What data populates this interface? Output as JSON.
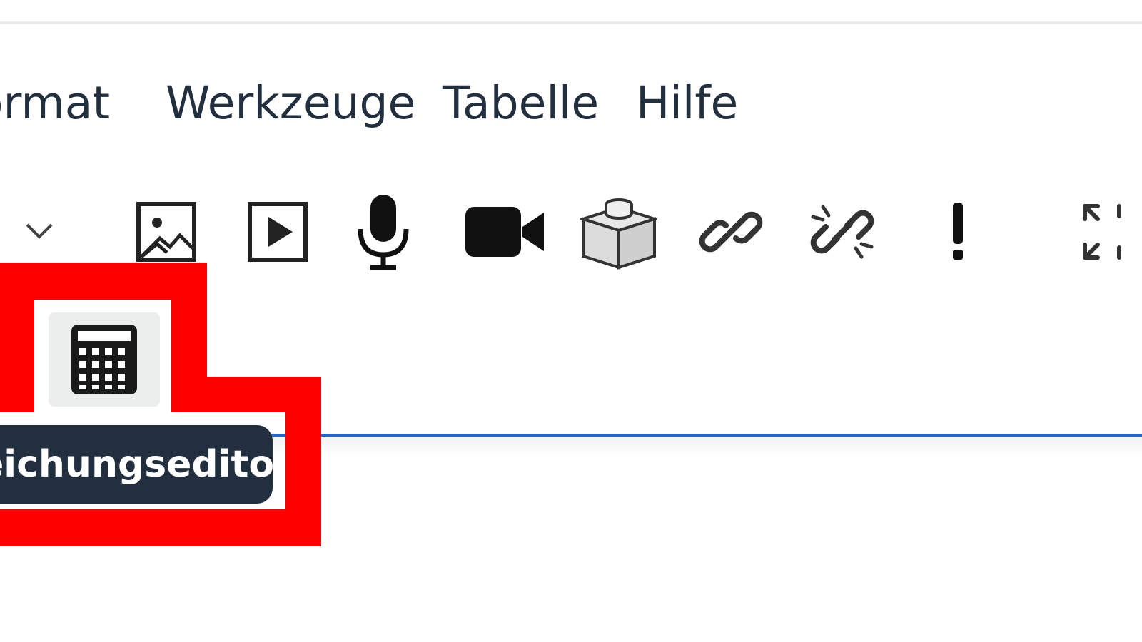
{
  "menubar": {
    "items": [
      {
        "label": "ormat"
      },
      {
        "label": "Werkzeuge"
      },
      {
        "label": "Tabelle"
      },
      {
        "label": "Hilfe"
      }
    ]
  },
  "toolbar": {
    "buttons": [
      {
        "icon": "chevron-down-icon"
      },
      {
        "icon": "image-icon"
      },
      {
        "icon": "media-play-icon"
      },
      {
        "icon": "microphone-icon"
      },
      {
        "icon": "video-camera-icon"
      },
      {
        "icon": "h5p-block-icon"
      },
      {
        "icon": "link-icon"
      },
      {
        "icon": "unlink-icon"
      },
      {
        "icon": "exclamation-icon"
      },
      {
        "icon": "fullscreen-icon"
      }
    ],
    "math_button": {
      "icon": "calculator-icon"
    }
  },
  "tooltip": {
    "text": "eichungseditor"
  },
  "colors": {
    "menu_text": "#222f3e",
    "tooltip_bg": "#222f3e",
    "editor_border": "#2067c9",
    "highlight": "#ff0000"
  }
}
